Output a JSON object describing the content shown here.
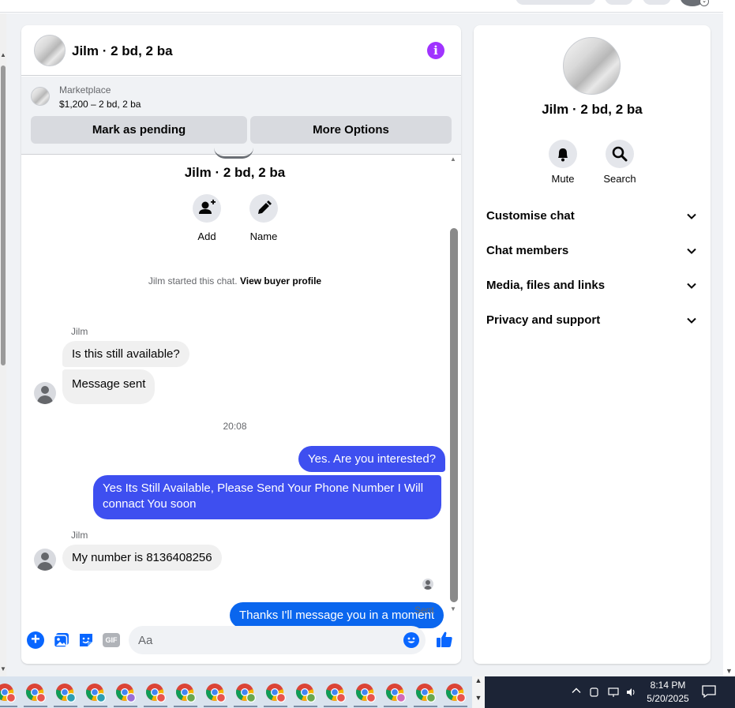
{
  "chat": {
    "header_title": "Jilm · 2 bd, 2 ba",
    "marketplace": {
      "label": "Marketplace",
      "price": "$1,200 – 2 bd, 2 ba",
      "mark_pending": "Mark as pending",
      "more_options": "More Options"
    },
    "conversation_title": "Jilm · 2 bd, 2 ba",
    "actions": {
      "add": "Add",
      "name": "Name"
    },
    "started_text": "Jilm started this chat.",
    "view_buyer_profile": "View buyer profile",
    "messages": [
      {
        "sender": "Jilm",
        "text": "Is this still available?",
        "direction": "incoming"
      },
      {
        "text": "Message sent",
        "direction": "incoming"
      },
      {
        "text": "Yes. Are you interested?",
        "direction": "outgoing"
      },
      {
        "text": "Yes Its Still Available, Please Send Your Phone Number I Will connact You soon",
        "direction": "outgoing"
      },
      {
        "sender": "Jilm",
        "text": "My number is 8136408256",
        "direction": "incoming"
      },
      {
        "text": "Thanks I'll message you in a moment",
        "direction": "outgoing"
      }
    ],
    "timestamp": "20:08",
    "sent_status": "Sent",
    "composer": {
      "placeholder": "Aa",
      "gif_label": "GIF"
    }
  },
  "info_panel": {
    "title": "Jilm · 2 bd, 2 ba",
    "actions": {
      "mute": "Mute",
      "search": "Search"
    },
    "sections": [
      "Customise chat",
      "Chat members",
      "Media, files and links",
      "Privacy and support"
    ]
  },
  "taskbar": {
    "time": "8:14 PM",
    "date": "5/20/2025",
    "app_icons": [
      "chrome-icon",
      "chrome-icon",
      "chrome-icon",
      "chrome-icon",
      "chrome-icon",
      "chrome-icon",
      "chrome-icon",
      "chrome-icon",
      "chrome-icon",
      "chrome-icon",
      "chrome-icon",
      "chrome-icon",
      "chrome-icon",
      "chrome-icon",
      "chrome-icon",
      "chrome-icon"
    ]
  },
  "colors": {
    "accent": "#0866ff",
    "outgoing_bubble": "#3e4ff0",
    "outgoing_bubble_alt": "#0a66ee",
    "info_icon": "#a033ff",
    "incoming_bubble": "#f0f0f0",
    "page_background": "#f0f2f5",
    "taskbar_dark": "#1c2436"
  }
}
